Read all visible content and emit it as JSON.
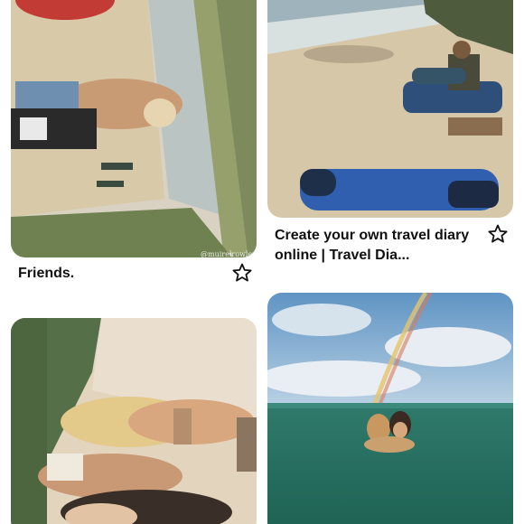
{
  "pins": [
    {
      "title": "Friends.",
      "watermark": "@muirelrowley",
      "icon": "star-outline-icon"
    },
    {
      "title": "Create your own travel diary online | Travel Dia...",
      "icon": "star-outline-icon"
    },
    {
      "title": "",
      "icon": "star-outline-icon"
    },
    {
      "title": "",
      "icon": "star-outline-icon"
    }
  ]
}
